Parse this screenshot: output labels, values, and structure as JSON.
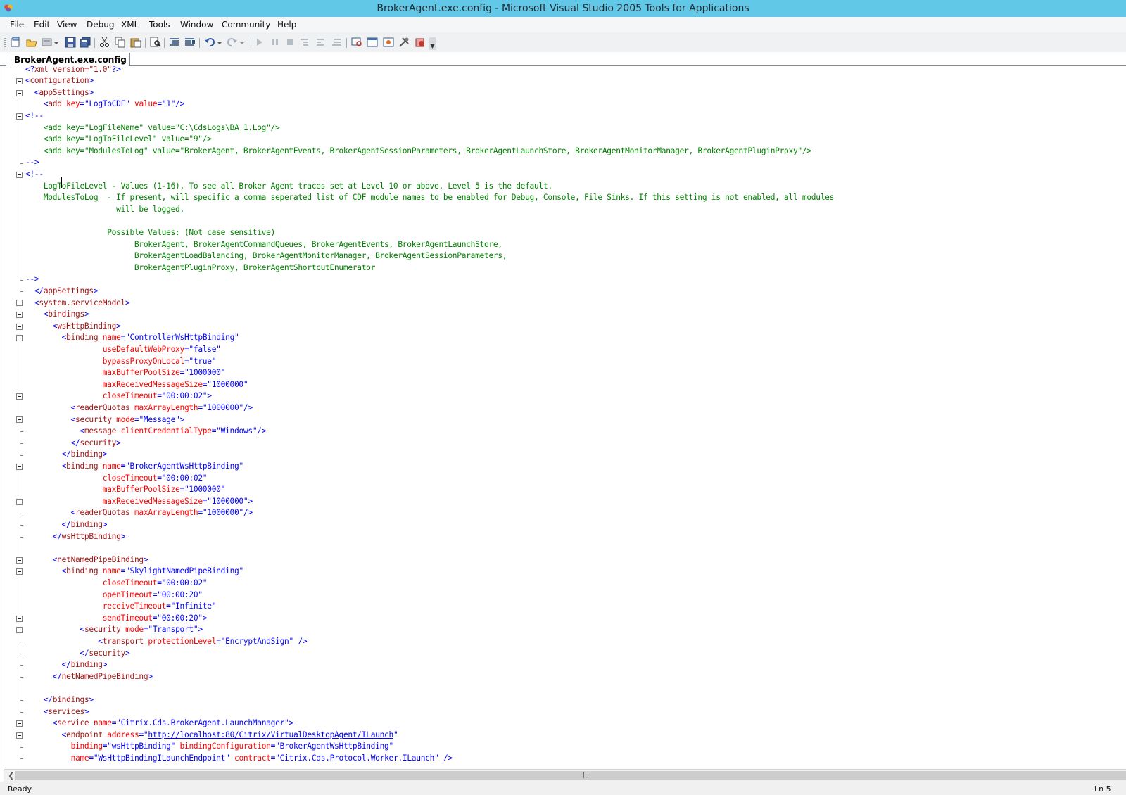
{
  "window": {
    "title": "BrokerAgent.exe.config - Microsoft Visual Studio 2005 Tools for Applications"
  },
  "menu": {
    "items": [
      "File",
      "Edit",
      "View",
      "Debug",
      "XML",
      "Tools",
      "Window",
      "Community",
      "Help"
    ]
  },
  "toolbar": {
    "buttons": [
      "new-project",
      "open-file",
      "add-item",
      "save",
      "save-all",
      "cut",
      "copy",
      "paste",
      "find",
      "comment",
      "uncomment",
      "undo",
      "redo",
      "start",
      "break",
      "stop",
      "step-into",
      "step-over",
      "step-out",
      "solution-explorer",
      "properties",
      "object-browser",
      "toolbox",
      "options"
    ]
  },
  "tabs": [
    {
      "label": "BrokerAgent.exe.config",
      "active": true
    }
  ],
  "colors": {
    "titlebar": "#62c8e8",
    "xml_bracket": "#0000ff",
    "xml_tag": "#a31515",
    "xml_attr": "#ff0000",
    "xml_value": "#0000ff",
    "xml_comment": "#008000"
  },
  "editor": {
    "lines": [
      [
        [
          "b",
          "<?"
        ],
        [
          "p",
          "xml version=\"1.0\""
        ],
        [
          "b",
          "?>"
        ]
      ],
      [
        [
          "b",
          "<"
        ],
        [
          "t",
          "configuration"
        ],
        [
          "b",
          ">"
        ]
      ],
      [
        [
          "s",
          "  "
        ],
        [
          "b",
          "<"
        ],
        [
          "t",
          "appSettings"
        ],
        [
          "b",
          ">"
        ]
      ],
      [
        [
          "s",
          "    "
        ],
        [
          "b",
          "<"
        ],
        [
          "t",
          "add"
        ],
        [
          "s",
          " "
        ],
        [
          "a",
          "key"
        ],
        [
          "b",
          "=\""
        ],
        [
          "v",
          "LogToCDF"
        ],
        [
          "b",
          "\""
        ],
        [
          "s",
          " "
        ],
        [
          "a",
          "value"
        ],
        [
          "b",
          "=\""
        ],
        [
          "v",
          "1"
        ],
        [
          "b",
          "\"/>"
        ]
      ],
      [
        [
          "b",
          "<!--"
        ]
      ],
      [
        [
          "c",
          "    <add key=\"LogFileName\" value=\"C:\\CdsLogs\\BA_1.Log\"/>"
        ]
      ],
      [
        [
          "c",
          "    <add key=\"LogToFileLevel\" value=\"9\"/>"
        ]
      ],
      [
        [
          "c",
          "    <add key=\"ModulesToLog\" value=\"BrokerAgent, BrokerAgentEvents, BrokerAgentSessionParameters, BrokerAgentLaunchStore, BrokerAgentMonitorManager, BrokerAgentPluginProxy\"/>"
        ]
      ],
      [
        [
          "b",
          "-->"
        ]
      ],
      [
        [
          "b",
          "<!--"
        ]
      ],
      [
        [
          "c",
          "    LogToFileLevel - Values (1-16), To see all Broker Agent traces set at Level 10 or above. Level 5 is the default."
        ]
      ],
      [
        [
          "c",
          "    ModulesToLog  - If present, will specific a comma seperated list of CDF module names to be enabled for Debug, Console, File Sinks. If this setting is not enabled, all modules"
        ]
      ],
      [
        [
          "c",
          "                    will be logged."
        ]
      ],
      [
        [
          "c",
          ""
        ]
      ],
      [
        [
          "c",
          "                  Possible Values: (Not case sensitive)"
        ]
      ],
      [
        [
          "c",
          "                        BrokerAgent, BrokerAgentCommandQueues, BrokerAgentEvents, BrokerAgentLaunchStore,"
        ]
      ],
      [
        [
          "c",
          "                        BrokerAgentLoadBalancing, BrokerAgentMonitorManager, BrokerAgentSessionParameters,"
        ]
      ],
      [
        [
          "c",
          "                        BrokerAgentPluginProxy, BrokerAgentShortcutEnumerator"
        ]
      ],
      [
        [
          "b",
          "-->"
        ]
      ],
      [
        [
          "s",
          "  "
        ],
        [
          "b",
          "</"
        ],
        [
          "t",
          "appSettings"
        ],
        [
          "b",
          ">"
        ]
      ],
      [
        [
          "s",
          "  "
        ],
        [
          "b",
          "<"
        ],
        [
          "t",
          "system.serviceModel"
        ],
        [
          "b",
          ">"
        ]
      ],
      [
        [
          "s",
          "    "
        ],
        [
          "b",
          "<"
        ],
        [
          "t",
          "bindings"
        ],
        [
          "b",
          ">"
        ]
      ],
      [
        [
          "s",
          "      "
        ],
        [
          "b",
          "<"
        ],
        [
          "t",
          "wsHttpBinding"
        ],
        [
          "b",
          ">"
        ]
      ],
      [
        [
          "s",
          "        "
        ],
        [
          "b",
          "<"
        ],
        [
          "t",
          "binding"
        ],
        [
          "s",
          " "
        ],
        [
          "a",
          "name"
        ],
        [
          "b",
          "=\""
        ],
        [
          "v",
          "ControllerWsHttpBinding"
        ],
        [
          "b",
          "\""
        ]
      ],
      [
        [
          "s",
          "                 "
        ],
        [
          "a",
          "useDefaultWebProxy"
        ],
        [
          "b",
          "=\""
        ],
        [
          "v",
          "false"
        ],
        [
          "b",
          "\""
        ]
      ],
      [
        [
          "s",
          "                 "
        ],
        [
          "a",
          "bypassProxyOnLocal"
        ],
        [
          "b",
          "=\""
        ],
        [
          "v",
          "true"
        ],
        [
          "b",
          "\""
        ]
      ],
      [
        [
          "s",
          "                 "
        ],
        [
          "a",
          "maxBufferPoolSize"
        ],
        [
          "b",
          "=\""
        ],
        [
          "v",
          "1000000"
        ],
        [
          "b",
          "\""
        ]
      ],
      [
        [
          "s",
          "                 "
        ],
        [
          "a",
          "maxReceivedMessageSize"
        ],
        [
          "b",
          "=\""
        ],
        [
          "v",
          "1000000"
        ],
        [
          "b",
          "\""
        ]
      ],
      [
        [
          "s",
          "                 "
        ],
        [
          "a",
          "closeTimeout"
        ],
        [
          "b",
          "=\""
        ],
        [
          "v",
          "00:00:02"
        ],
        [
          "b",
          "\">"
        ]
      ],
      [
        [
          "s",
          "          "
        ],
        [
          "b",
          "<"
        ],
        [
          "t",
          "readerQuotas"
        ],
        [
          "s",
          " "
        ],
        [
          "a",
          "maxArrayLength"
        ],
        [
          "b",
          "=\""
        ],
        [
          "v",
          "1000000"
        ],
        [
          "b",
          "\"/>"
        ]
      ],
      [
        [
          "s",
          "          "
        ],
        [
          "b",
          "<"
        ],
        [
          "t",
          "security"
        ],
        [
          "s",
          " "
        ],
        [
          "a",
          "mode"
        ],
        [
          "b",
          "=\""
        ],
        [
          "v",
          "Message"
        ],
        [
          "b",
          "\">"
        ]
      ],
      [
        [
          "s",
          "            "
        ],
        [
          "b",
          "<"
        ],
        [
          "t",
          "message"
        ],
        [
          "s",
          " "
        ],
        [
          "a",
          "clientCredentialType"
        ],
        [
          "b",
          "=\""
        ],
        [
          "v",
          "Windows"
        ],
        [
          "b",
          "\"/>"
        ]
      ],
      [
        [
          "s",
          "          "
        ],
        [
          "b",
          "</"
        ],
        [
          "t",
          "security"
        ],
        [
          "b",
          ">"
        ]
      ],
      [
        [
          "s",
          "        "
        ],
        [
          "b",
          "</"
        ],
        [
          "t",
          "binding"
        ],
        [
          "b",
          ">"
        ]
      ],
      [
        [
          "s",
          "        "
        ],
        [
          "b",
          "<"
        ],
        [
          "t",
          "binding"
        ],
        [
          "s",
          " "
        ],
        [
          "a",
          "name"
        ],
        [
          "b",
          "=\""
        ],
        [
          "v",
          "BrokerAgentWsHttpBinding"
        ],
        [
          "b",
          "\""
        ]
      ],
      [
        [
          "s",
          "                 "
        ],
        [
          "a",
          "closeTimeout"
        ],
        [
          "b",
          "=\""
        ],
        [
          "v",
          "00:00:02"
        ],
        [
          "b",
          "\""
        ]
      ],
      [
        [
          "s",
          "                 "
        ],
        [
          "a",
          "maxBufferPoolSize"
        ],
        [
          "b",
          "=\""
        ],
        [
          "v",
          "1000000"
        ],
        [
          "b",
          "\""
        ]
      ],
      [
        [
          "s",
          "                 "
        ],
        [
          "a",
          "maxReceivedMessageSize"
        ],
        [
          "b",
          "=\""
        ],
        [
          "v",
          "1000000"
        ],
        [
          "b",
          "\">"
        ]
      ],
      [
        [
          "s",
          "          "
        ],
        [
          "b",
          "<"
        ],
        [
          "t",
          "readerQuotas"
        ],
        [
          "s",
          " "
        ],
        [
          "a",
          "maxArrayLength"
        ],
        [
          "b",
          "=\""
        ],
        [
          "v",
          "1000000"
        ],
        [
          "b",
          "\"/>"
        ]
      ],
      [
        [
          "s",
          "        "
        ],
        [
          "b",
          "</"
        ],
        [
          "t",
          "binding"
        ],
        [
          "b",
          ">"
        ]
      ],
      [
        [
          "s",
          "      "
        ],
        [
          "b",
          "</"
        ],
        [
          "t",
          "wsHttpBinding"
        ],
        [
          "b",
          ">"
        ]
      ],
      [
        [
          "s",
          ""
        ]
      ],
      [
        [
          "s",
          "      "
        ],
        [
          "b",
          "<"
        ],
        [
          "t",
          "netNamedPipeBinding"
        ],
        [
          "b",
          ">"
        ]
      ],
      [
        [
          "s",
          "        "
        ],
        [
          "b",
          "<"
        ],
        [
          "t",
          "binding"
        ],
        [
          "s",
          " "
        ],
        [
          "a",
          "name"
        ],
        [
          "b",
          "=\""
        ],
        [
          "v",
          "SkylightNamedPipeBinding"
        ],
        [
          "b",
          "\""
        ]
      ],
      [
        [
          "s",
          "                 "
        ],
        [
          "a",
          "closeTimeout"
        ],
        [
          "b",
          "=\""
        ],
        [
          "v",
          "00:00:02"
        ],
        [
          "b",
          "\""
        ]
      ],
      [
        [
          "s",
          "                 "
        ],
        [
          "a",
          "openTimeout"
        ],
        [
          "b",
          "=\""
        ],
        [
          "v",
          "00:00:20"
        ],
        [
          "b",
          "\""
        ]
      ],
      [
        [
          "s",
          "                 "
        ],
        [
          "a",
          "receiveTimeout"
        ],
        [
          "b",
          "=\""
        ],
        [
          "v",
          "Infinite"
        ],
        [
          "b",
          "\""
        ]
      ],
      [
        [
          "s",
          "                 "
        ],
        [
          "a",
          "sendTimeout"
        ],
        [
          "b",
          "=\""
        ],
        [
          "v",
          "00:00:20"
        ],
        [
          "b",
          "\">"
        ]
      ],
      [
        [
          "s",
          "            "
        ],
        [
          "b",
          "<"
        ],
        [
          "t",
          "security"
        ],
        [
          "s",
          " "
        ],
        [
          "a",
          "mode"
        ],
        [
          "b",
          "=\""
        ],
        [
          "v",
          "Transport"
        ],
        [
          "b",
          "\">"
        ]
      ],
      [
        [
          "s",
          "                "
        ],
        [
          "b",
          "<"
        ],
        [
          "t",
          "transport"
        ],
        [
          "s",
          " "
        ],
        [
          "a",
          "protectionLevel"
        ],
        [
          "b",
          "=\""
        ],
        [
          "v",
          "EncryptAndSign"
        ],
        [
          "b",
          "\" />"
        ]
      ],
      [
        [
          "s",
          "            "
        ],
        [
          "b",
          "</"
        ],
        [
          "t",
          "security"
        ],
        [
          "b",
          ">"
        ]
      ],
      [
        [
          "s",
          "        "
        ],
        [
          "b",
          "</"
        ],
        [
          "t",
          "binding"
        ],
        [
          "b",
          ">"
        ]
      ],
      [
        [
          "s",
          "      "
        ],
        [
          "b",
          "</"
        ],
        [
          "t",
          "netNamedPipeBinding"
        ],
        [
          "b",
          ">"
        ]
      ],
      [
        [
          "s",
          ""
        ]
      ],
      [
        [
          "s",
          "    "
        ],
        [
          "b",
          "</"
        ],
        [
          "t",
          "bindings"
        ],
        [
          "b",
          ">"
        ]
      ],
      [
        [
          "s",
          "    "
        ],
        [
          "b",
          "<"
        ],
        [
          "t",
          "services"
        ],
        [
          "b",
          ">"
        ]
      ],
      [
        [
          "s",
          "      "
        ],
        [
          "b",
          "<"
        ],
        [
          "t",
          "service"
        ],
        [
          "s",
          " "
        ],
        [
          "a",
          "name"
        ],
        [
          "b",
          "=\""
        ],
        [
          "v",
          "Citrix.Cds.BrokerAgent.LaunchManager"
        ],
        [
          "b",
          "\">"
        ]
      ],
      [
        [
          "s",
          "        "
        ],
        [
          "b",
          "<"
        ],
        [
          "t",
          "endpoint"
        ],
        [
          "s",
          " "
        ],
        [
          "a",
          "address"
        ],
        [
          "b",
          "=\""
        ],
        [
          "l",
          "http://localhost:80/Citrix/VirtualDesktopAgent/ILaunch"
        ],
        [
          "b",
          "\""
        ]
      ],
      [
        [
          "s",
          "          "
        ],
        [
          "a",
          "binding"
        ],
        [
          "b",
          "=\""
        ],
        [
          "v",
          "wsHttpBinding"
        ],
        [
          "b",
          "\""
        ],
        [
          "s",
          " "
        ],
        [
          "a",
          "bindingConfiguration"
        ],
        [
          "b",
          "=\""
        ],
        [
          "v",
          "BrokerAgentWsHttpBinding"
        ],
        [
          "b",
          "\""
        ]
      ],
      [
        [
          "s",
          "          "
        ],
        [
          "a",
          "name"
        ],
        [
          "b",
          "=\""
        ],
        [
          "v",
          "WsHttpBindingILaunchEndpoint"
        ],
        [
          "b",
          "\""
        ],
        [
          "s",
          " "
        ],
        [
          "a",
          "contract"
        ],
        [
          "b",
          "=\""
        ],
        [
          "v",
          "Citrix.Cds.Protocol.Worker.ILaunch"
        ],
        [
          "b",
          "\" />"
        ]
      ]
    ]
  },
  "status": {
    "text": "Ready",
    "line": "Ln 5"
  }
}
